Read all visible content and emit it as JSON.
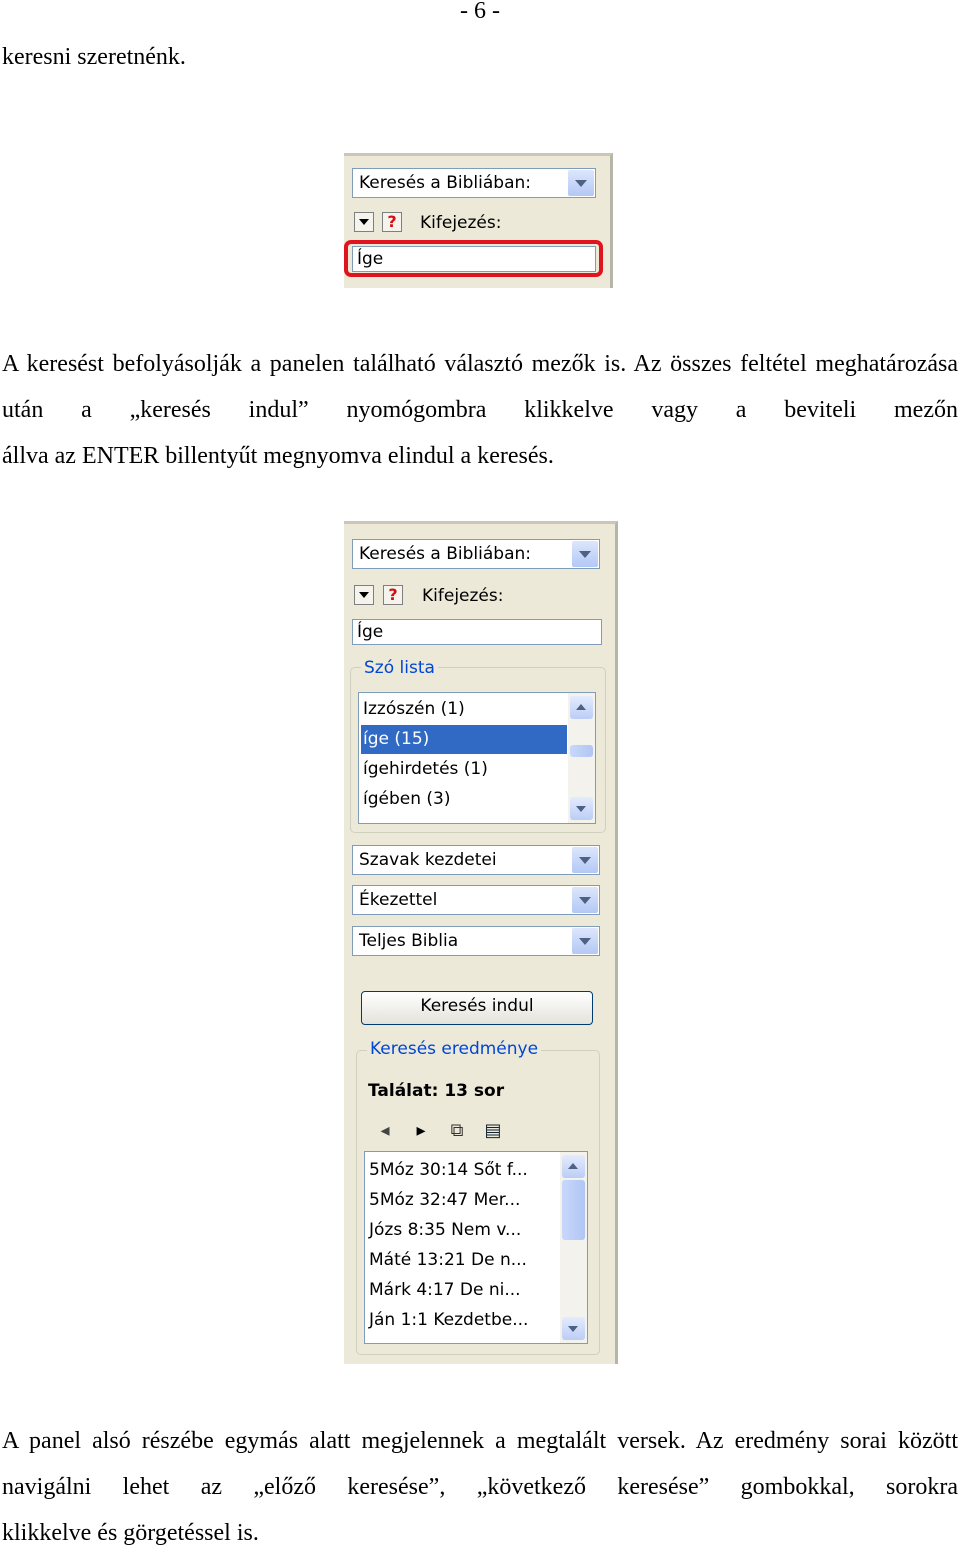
{
  "page": {
    "number": "- 6 -",
    "line1": "keresni szeretnénk.",
    "para2_line1": "A keresést befolyásolják a panelen található választó mezők is. Az összes feltétel",
    "para2_line2": "meghatározása után a „keresés indul” nyomógombra klikkelve vagy a beviteli mezőn",
    "para2_line3": "állva az ENTER billentyűt megnyomva elindul a keresés.",
    "para3_line1": "A panel alsó részébe egymás alatt megjelennek a megtalált versek. Az eredmény sorai",
    "para3_line2": "között navigálni lehet az „előző keresése”, „következő keresése” gombokkal, sorokra",
    "para3_line3": "klikkelve és görgetéssel is."
  },
  "shot1": {
    "scope_select": "Keresés a Bibliában:",
    "help_glyph": "?",
    "expression_label": "Kifejezés:",
    "expression_value": "Íge"
  },
  "shot2": {
    "scope_select": "Keresés a Bibliában:",
    "help_glyph": "?",
    "expression_label": "Kifejezés:",
    "expression_value": "Íge",
    "wordlist_title": "Szó lista",
    "wordlist": [
      "Izzószén (1)",
      "íge (15)",
      "ígehirdetés (1)",
      "ígében (3)"
    ],
    "wordlist_selected": 1,
    "match_mode": "Szavak kezdetei",
    "accent_mode": "Ékezettel",
    "range": "Teljes Biblia",
    "search_button": "Keresés indul",
    "results_title": "Keresés eredménye",
    "hits": "Találat: 13 sor",
    "tools": {
      "prev_glyph": "◂",
      "next_glyph": "▸",
      "copy_glyph": "⧉",
      "book_glyph": "▤"
    },
    "results": [
      "5Móz 30:14 Sőt f...",
      "5Móz 32:47 Mer...",
      "Józs 8:35 Nem v...",
      "Máté 13:21 De n...",
      "Márk 4:17 De ni...",
      "Ján 1:1 Kezdetbe..."
    ]
  }
}
